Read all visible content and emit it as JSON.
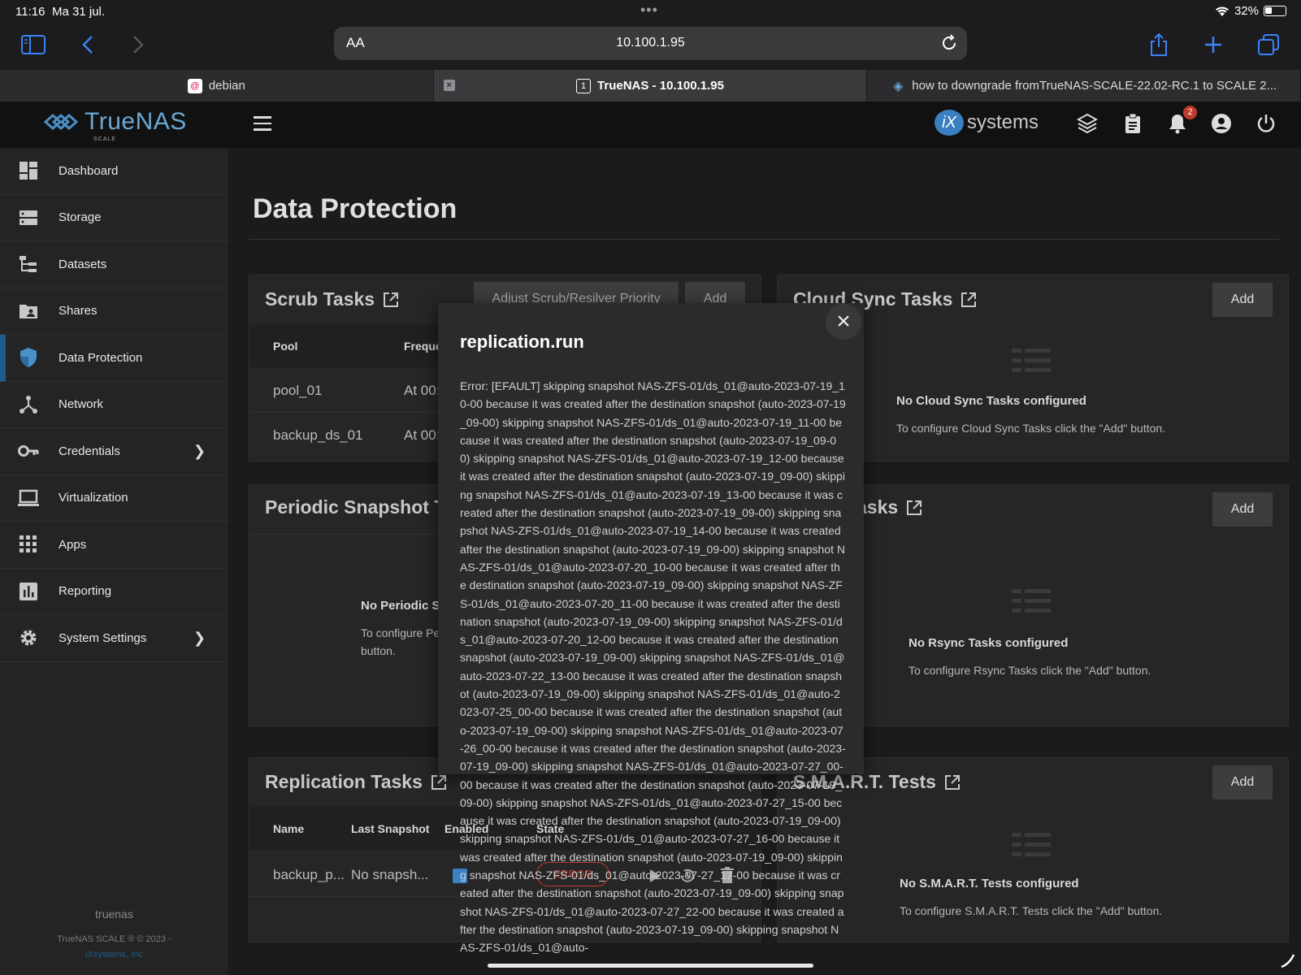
{
  "status": {
    "time": "11:16",
    "date": "Ma 31 jul.",
    "battery": "32%"
  },
  "browser": {
    "aa": "AA",
    "url": "10.100.1.95",
    "tabs": [
      {
        "label": "debian"
      },
      {
        "label": "TrueNAS - 10.100.1.95",
        "favicon_text": "1"
      },
      {
        "label": "how to downgrade fromTrueNAS-SCALE-22.02-RC.1 to SCALE 2..."
      }
    ]
  },
  "app": {
    "logo": "TrueNAS",
    "logo_sub": "SCALE",
    "ix_letters": "iX",
    "ix_word": "systems",
    "notification_count": "2"
  },
  "sidebar": {
    "items": [
      {
        "label": "Dashboard"
      },
      {
        "label": "Storage"
      },
      {
        "label": "Datasets"
      },
      {
        "label": "Shares"
      },
      {
        "label": "Data Protection"
      },
      {
        "label": "Network"
      },
      {
        "label": "Credentials"
      },
      {
        "label": "Virtualization"
      },
      {
        "label": "Apps"
      },
      {
        "label": "Reporting"
      },
      {
        "label": "System Settings"
      }
    ],
    "hostname": "truenas",
    "copyright": "TrueNAS SCALE ® © 2023 -",
    "company": "iXsystems, Inc"
  },
  "page": {
    "title": "Data Protection"
  },
  "scrub": {
    "title": "Scrub Tasks",
    "priority_button": "Adjust Scrub/Resilver Priority",
    "add": "Add",
    "col_pool": "Pool",
    "col_freq": "Freque",
    "rows": [
      {
        "pool": "pool_01",
        "freq": "At 00:"
      },
      {
        "pool": "backup_ds_01",
        "freq": "At 00:"
      }
    ]
  },
  "cloud": {
    "title": "Cloud Sync Tasks",
    "add": "Add",
    "empty_title": "No Cloud Sync Tasks configured",
    "empty_text": "To configure Cloud Sync Tasks click the \"Add\" button."
  },
  "periodic": {
    "title": "Periodic Snapshot Ta",
    "empty_title": "No Periodic S",
    "empty_text1": "To configure Pe",
    "empty_text2": "button."
  },
  "rsync": {
    "title": "asks",
    "add": "Add",
    "empty_title": "No Rsync Tasks configured",
    "empty_text": "To configure Rsync Tasks click the \"Add\" button."
  },
  "replication": {
    "title": "Replication Tasks",
    "cols": {
      "name": "Name",
      "last": "Last Snapshot",
      "enabled": "Enabled",
      "state": "State"
    },
    "row": {
      "name": "backup_p...",
      "last": "No snapsh...",
      "state": "ERROR"
    }
  },
  "smart": {
    "title": "S.M.A.R.T. Tests",
    "add": "Add",
    "empty_title": "No S.M.A.R.T. Tests configured",
    "empty_text": "To configure S.M.A.R.T. Tests click the \"Add\" button."
  },
  "modal": {
    "title": "replication.run",
    "error_text": "Error: [EFAULT] skipping snapshot NAS-ZFS-01/ds_01@auto-2023-07-19_10-00 because it was created after the destination snapshot (auto-2023-07-19_09-00) skipping snapshot NAS-ZFS-01/ds_01@auto-2023-07-19_11-00 because it was created after the destination snapshot (auto-2023-07-19_09-00) skipping snapshot NAS-ZFS-01/ds_01@auto-2023-07-19_12-00 because it was created after the destination snapshot (auto-2023-07-19_09-00) skipping snapshot NAS-ZFS-01/ds_01@auto-2023-07-19_13-00 because it was created after the destination snapshot (auto-2023-07-19_09-00) skipping snapshot NAS-ZFS-01/ds_01@auto-2023-07-19_14-00 because it was created after the destination snapshot (auto-2023-07-19_09-00) skipping snapshot NAS-ZFS-01/ds_01@auto-2023-07-20_10-00 because it was created after the destination snapshot (auto-2023-07-19_09-00) skipping snapshot NAS-ZFS-01/ds_01@auto-2023-07-20_11-00 because it was created after the destination snapshot (auto-2023-07-19_09-00) skipping snapshot NAS-ZFS-01/ds_01@auto-2023-07-20_12-00 because it was created after the destination snapshot (auto-2023-07-19_09-00) skipping snapshot NAS-ZFS-01/ds_01@auto-2023-07-22_13-00 because it was created after the destination snapshot (auto-2023-07-19_09-00) skipping snapshot NAS-ZFS-01/ds_01@auto-2023-07-25_00-00 because it was created after the destination snapshot (auto-2023-07-19_09-00) skipping snapshot NAS-ZFS-01/ds_01@auto-2023-07-26_00-00 because it was created after the destination snapshot (auto-2023-07-19_09-00) skipping snapshot NAS-ZFS-01/ds_01@auto-2023-07-27_00-00 because it was created after the destination snapshot (auto-2023-07-19_09-00) skipping snapshot NAS-ZFS-01/ds_01@auto-2023-07-27_15-00 because it was created after the destination snapshot (auto-2023-07-19_09-00) skipping snapshot NAS-ZFS-01/ds_01@auto-2023-07-27_16-00 because it was created after the destination snapshot (auto-2023-07-19_09-00) skipping snapshot NAS-ZFS-01/ds_01@auto-2023-07-27_17-00 because it was created after the destination snapshot (auto-2023-07-19_09-00) skipping snapshot NAS-ZFS-01/ds_01@auto-2023-07-27_22-00 because it was created after the destination snapshot (auto-2023-07-19_09-00) skipping snapshot NAS-ZFS-01/ds_01@auto-"
  },
  "colors": {
    "accent": "#1e5c8a",
    "brand": "#6aa8d4",
    "safari_blue": "#3b82f6",
    "error": "#c0392b"
  },
  "icons": [
    "sidebar-icon",
    "back-icon",
    "forward-icon",
    "reload-icon",
    "share-icon",
    "plus-icon",
    "tabs-icon",
    "menu-icon",
    "truecommand-icon",
    "clipboard-icon",
    "bell-icon",
    "account-icon",
    "power-icon",
    "external-link-icon",
    "close-icon",
    "play-icon",
    "restore-icon",
    "delete-icon"
  ]
}
